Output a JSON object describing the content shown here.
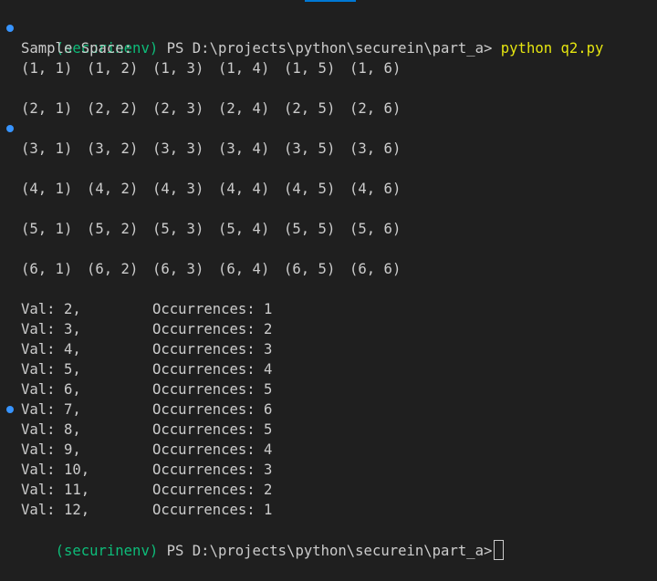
{
  "prompt_start": {
    "env": "(securinenv)",
    "ps": "PS",
    "path": "D:\\projects\\python\\securein\\part_a>",
    "command": "python q2.py"
  },
  "sample_space_label": "Sample Space:",
  "sample_rows": [
    [
      "(1, 1)",
      "(1, 2)",
      "(1, 3)",
      "(1, 4)",
      "(1, 5)",
      "(1, 6)"
    ],
    [
      "(2, 1)",
      "(2, 2)",
      "(2, 3)",
      "(2, 4)",
      "(2, 5)",
      "(2, 6)"
    ],
    [
      "(3, 1)",
      "(3, 2)",
      "(3, 3)",
      "(3, 4)",
      "(3, 5)",
      "(3, 6)"
    ],
    [
      "(4, 1)",
      "(4, 2)",
      "(4, 3)",
      "(4, 4)",
      "(4, 5)",
      "(4, 6)"
    ],
    [
      "(5, 1)",
      "(5, 2)",
      "(5, 3)",
      "(5, 4)",
      "(5, 5)",
      "(5, 6)"
    ],
    [
      "(6, 1)",
      "(6, 2)",
      "(6, 3)",
      "(6, 4)",
      "(6, 5)",
      "(6, 6)"
    ]
  ],
  "occurrences": [
    {
      "val": "Val: 2,",
      "occ": "Occurrences: 1"
    },
    {
      "val": "Val: 3,",
      "occ": "Occurrences: 2"
    },
    {
      "val": "Val: 4,",
      "occ": "Occurrences: 3"
    },
    {
      "val": "Val: 5,",
      "occ": "Occurrences: 4"
    },
    {
      "val": "Val: 6,",
      "occ": "Occurrences: 5"
    },
    {
      "val": "Val: 7,",
      "occ": "Occurrences: 6"
    },
    {
      "val": "Val: 8,",
      "occ": "Occurrences: 5"
    },
    {
      "val": "Val: 9,",
      "occ": "Occurrences: 4"
    },
    {
      "val": "Val: 10,",
      "occ": "Occurrences: 3"
    },
    {
      "val": "Val: 11,",
      "occ": "Occurrences: 2"
    },
    {
      "val": "Val: 12,",
      "occ": "Occurrences: 1"
    }
  ],
  "prompt_end": {
    "env": "(securinenv)",
    "ps": "PS",
    "path": "D:\\projects\\python\\securein\\part_a>"
  },
  "colors": {
    "background": "#1f1f1f",
    "text": "#cccccc",
    "env": "#0dbc79",
    "command": "#e5e510",
    "decoration_dot": "#3794ff"
  }
}
